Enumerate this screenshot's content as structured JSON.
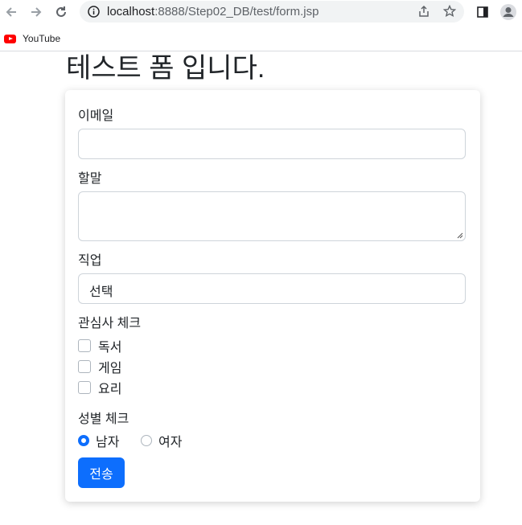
{
  "browser": {
    "url_host": "localhost",
    "url_rest": ":8888/Step02_DB/test/form.jsp",
    "bookmarks": [
      {
        "label": "YouTube"
      }
    ]
  },
  "page": {
    "title": "테스트 폼 입니다."
  },
  "form": {
    "email_label": "이메일",
    "email_value": "",
    "message_label": "할말",
    "message_value": "",
    "job_label": "직업",
    "job_selected": "선택",
    "interest_label": "관심사 체크",
    "interests": [
      {
        "label": "독서",
        "checked": false
      },
      {
        "label": "게임",
        "checked": false
      },
      {
        "label": "요리",
        "checked": false
      }
    ],
    "gender_label": "성별 체크",
    "genders": [
      {
        "label": "남자",
        "checked": true
      },
      {
        "label": "여자",
        "checked": false
      }
    ],
    "submit_label": "전송"
  },
  "colors": {
    "primary": "#0d6efd",
    "border": "#ced4da"
  }
}
